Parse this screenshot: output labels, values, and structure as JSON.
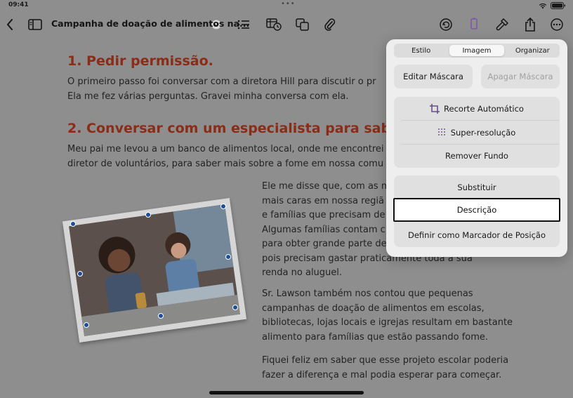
{
  "status": {
    "time": "09:41"
  },
  "toolbar": {
    "title": "Campanha de doação de alimentos na..."
  },
  "doc": {
    "h1": "1.   Pedir permissão.",
    "p1_line1": "O primeiro passo foi conversar com a diretora Hill para discutir o pr",
    "p1_line2": "Ela me fez várias perguntas. Gravei minha conversa com ela.",
    "h2": "2.   Conversar com um especialista para sabe",
    "p2_line1": "Meu pai me levou a um banco de alimentos local, onde me encontrei c",
    "p2_line2": "diretor de voluntários, para saber mais sobre a fome em nossa comu",
    "r1": "Ele me disse que, com as m",
    "r2": "mais caras em nossa regiã",
    "r3": "e famílias que precisam de c",
    "r4": "Algumas famílias contam c",
    "r5": "para obter grande parte de",
    "r6": "pois precisam gastar praticamente toda a sua",
    "r7": "renda no aluguel.",
    "s1": "Sr. Lawson também nos contou que pequenas",
    "s2": "campanhas de doação de alimentos em escolas,",
    "s3": "bibliotecas, lojas locais e igrejas resultam em bastante",
    "s4": "alimento para famílias que estão passando fome.",
    "f1": "Fiquei feliz em saber que esse projeto escolar poderia",
    "f2": "fazer a diferença e mal podia esperar para começar."
  },
  "popover": {
    "tabs": [
      "Estilo",
      "Imagem",
      "Organizar"
    ],
    "edit_mask": "Editar Máscara",
    "clear_mask": "Apagar Máscara",
    "auto_crop": "Recorte Automático",
    "super_res": "Super-resolução",
    "remove_bg": "Remover Fundo",
    "replace": "Substituir",
    "description": "Descrição",
    "placeholder": "Definir como Marcador de Posição"
  },
  "colors": {
    "heading": "#c2482a",
    "overlay": "#8e8e8e"
  }
}
